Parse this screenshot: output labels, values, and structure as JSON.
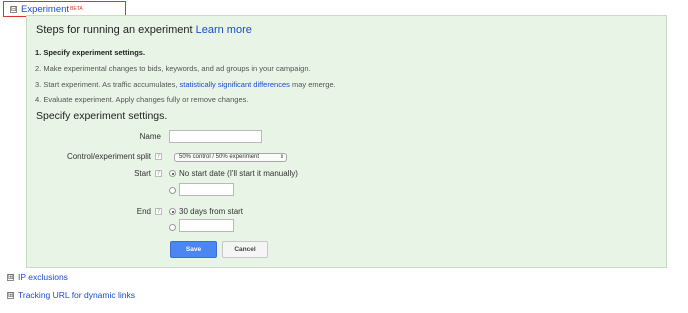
{
  "experiment": {
    "toggle": "⊟",
    "title": "Experiment",
    "beta": "BETA"
  },
  "steps": {
    "title": "Steps for running an experiment",
    "learn_more": "Learn more",
    "step1": "1. Specify experiment settings.",
    "step2": "2. Make experimental changes to bids, keywords, and ad groups in your campaign.",
    "step3_pre": "3. Start experiment. As traffic accumulates,",
    "step3_link": "statistically significant differences",
    "step3_post": "may emerge.",
    "step4": "4. Evaluate experiment. Apply changes fully or remove changes."
  },
  "settings": {
    "title": "Specify experiment settings.",
    "name_label": "Name",
    "name_value": "",
    "split_label": "Control/experiment split",
    "split_selected": "50% control / 50% experiment",
    "start_label": "Start",
    "start_option": "No start date (I'll start it manually)",
    "start_option_selected": true,
    "start_date_value": "",
    "end_label": "End",
    "end_option": "30 days from start",
    "end_option_selected": true,
    "end_date_value": "",
    "help_glyph": "?",
    "save": "Save",
    "cancel": "Cancel"
  },
  "sections": [
    {
      "toggle": "⊞",
      "label": "IP exclusions"
    },
    {
      "toggle": "⊞",
      "label": "Tracking URL for dynamic links"
    }
  ],
  "colors": {
    "link": "#1a4bd4",
    "panel_bg": "#e8f4e6",
    "save_bg": "#4c86f2",
    "highlight_border": "#d9352b"
  }
}
